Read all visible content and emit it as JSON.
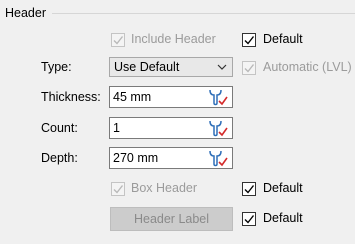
{
  "group": {
    "title": "Header"
  },
  "include_header": {
    "label": "Include Header",
    "checked": true,
    "enabled": false
  },
  "include_header_default": {
    "label": "Default",
    "checked": true
  },
  "type": {
    "label": "Type:",
    "value": "Use Default"
  },
  "automatic": {
    "label": "Automatic (LVL)",
    "checked": true,
    "enabled": false
  },
  "thickness": {
    "label": "Thickness:",
    "value": "45 mm"
  },
  "count": {
    "label": "Count:",
    "value": "1"
  },
  "depth": {
    "label": "Depth:",
    "value": "270 mm"
  },
  "box_header": {
    "label": "Box Header",
    "checked": true,
    "enabled": false
  },
  "box_header_default": {
    "label": "Default",
    "checked": true
  },
  "header_label_button": {
    "label": "Header Label",
    "enabled": false
  },
  "header_label_default": {
    "label": "Default",
    "checked": true
  },
  "colors": {
    "enabled_check": "#000000",
    "disabled_check": "#b8b8b8",
    "wrench_blue": "#2f6fb8",
    "wrench_red": "#d42a2a"
  },
  "icons": {
    "field_action": "wrench-check-icon",
    "dropdown": "chevron-down-icon"
  }
}
